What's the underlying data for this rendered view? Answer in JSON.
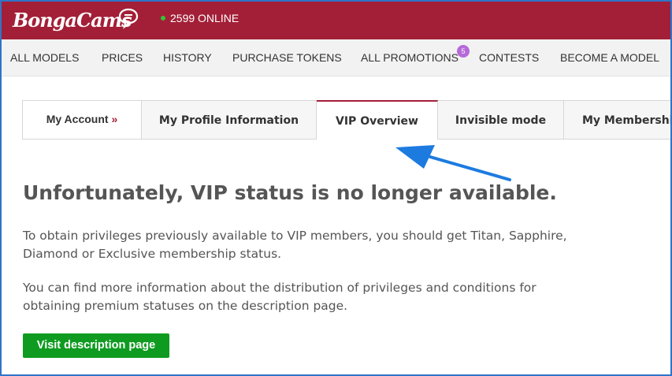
{
  "header": {
    "logo_text": "BongaCams",
    "online_count": "2599 ONLINE",
    "colors": {
      "brand": "#a31f37",
      "online_dot": "#35c23b"
    }
  },
  "nav": {
    "items": [
      "ALL MODELS",
      "PRICES",
      "HISTORY",
      "PURCHASE TOKENS",
      "ALL PROMOTIONS",
      "CONTESTS",
      "BECOME A MODEL"
    ],
    "promotions_badge": "5"
  },
  "tabs": {
    "my_account": "My Account",
    "my_account_suffix": "»",
    "items": [
      "My Profile Information",
      "VIP Overview",
      "Invisible mode",
      "My Membership"
    ],
    "active": "VIP Overview"
  },
  "main": {
    "headline": "Unfortunately, VIP status is no longer available.",
    "paragraph1": "To obtain privileges previously available to VIP members, you should get Titan, Sapphire, Diamond or Exclusive membership status.",
    "paragraph2": "You can find more information about the distribution of privileges and conditions for obtaining premium statuses on the description page.",
    "button_label": "Visit description page",
    "colors": {
      "button": "#0f9b20",
      "annotation_arrow": "#1d7be0"
    }
  }
}
